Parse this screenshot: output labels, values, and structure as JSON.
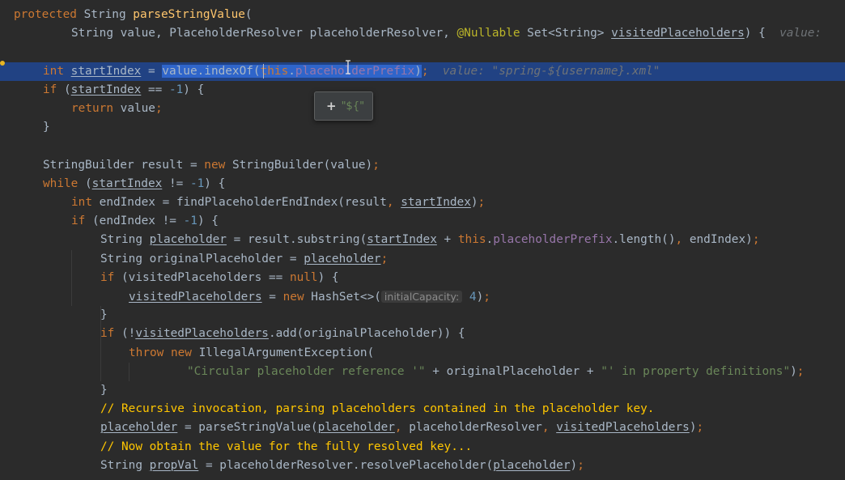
{
  "editor": {
    "language": "java",
    "lines": [
      [
        [
          "kw",
          "protected "
        ],
        [
          "p",
          "String "
        ],
        [
          "fn",
          "parseStringValue"
        ],
        [
          "p",
          "("
        ]
      ],
      [
        [
          "p",
          "String value, PlaceholderResolver placeholderResolver, "
        ],
        [
          "ann",
          "@Nullable "
        ],
        [
          "p",
          "Set<String> "
        ],
        [
          "ul",
          "visitedPlaceholders"
        ],
        [
          "p",
          ") {  "
        ],
        [
          "inlay",
          "value: "
        ]
      ],
      [],
      [
        [
          "kw",
          "int "
        ],
        [
          "ul",
          "startIndex"
        ],
        [
          "p",
          " = "
        ],
        [
          "sel",
          "value.indexOf("
        ],
        [
          "sel2",
          "this"
        ],
        [
          "sel3",
          "."
        ],
        [
          "selfld",
          "placeholderPrefix"
        ],
        [
          "sel3",
          ")"
        ],
        [
          "kw",
          ";"
        ],
        [
          "p",
          "  "
        ],
        [
          "inlay",
          "value: \"spring-${username}.xml\""
        ]
      ],
      [
        [
          "kw",
          "if "
        ],
        [
          "p",
          "("
        ],
        [
          "ul",
          "startIndex"
        ],
        [
          "p",
          " == "
        ],
        [
          "num",
          "-1"
        ],
        [
          "p",
          ") {"
        ]
      ],
      [
        [
          "kw",
          "return "
        ],
        [
          "p",
          "value"
        ],
        [
          "kw",
          ";"
        ]
      ],
      [
        [
          "p",
          "}"
        ]
      ],
      [],
      [
        [
          "p",
          "StringBuilder result = "
        ],
        [
          "kw",
          "new "
        ],
        [
          "p",
          "StringBuilder(value)"
        ],
        [
          "kw",
          ";"
        ]
      ],
      [
        [
          "kw",
          "while "
        ],
        [
          "p",
          "("
        ],
        [
          "ul",
          "startIndex"
        ],
        [
          "p",
          " != "
        ],
        [
          "num",
          "-1"
        ],
        [
          "p",
          ") {"
        ]
      ],
      [
        [
          "kw",
          "int "
        ],
        [
          "p",
          "endIndex = findPlaceholderEndIndex(result"
        ],
        [
          "kw",
          ", "
        ],
        [
          "ul",
          "startIndex"
        ],
        [
          "p",
          ")"
        ],
        [
          "kw",
          ";"
        ]
      ],
      [
        [
          "kw",
          "if "
        ],
        [
          "p",
          "(endIndex != "
        ],
        [
          "num",
          "-1"
        ],
        [
          "p",
          ") {"
        ]
      ],
      [
        [
          "p",
          "String "
        ],
        [
          "ul",
          "placeholder"
        ],
        [
          "p",
          " = result.substring("
        ],
        [
          "ul",
          "startIndex"
        ],
        [
          "p",
          " + "
        ],
        [
          "kw",
          "this"
        ],
        [
          "p",
          "."
        ],
        [
          "fld",
          "placeholderPrefix"
        ],
        [
          "p",
          ".length()"
        ],
        [
          "kw",
          ", "
        ],
        [
          "p",
          "endIndex)"
        ],
        [
          "kw",
          ";"
        ]
      ],
      [
        [
          "p",
          "String originalPlaceholder = "
        ],
        [
          "ul",
          "placeholder"
        ],
        [
          "kw",
          ";"
        ]
      ],
      [
        [
          "kw",
          "if "
        ],
        [
          "p",
          "(visitedPlaceholders == "
        ],
        [
          "kw",
          "null"
        ],
        [
          "p",
          ") {"
        ]
      ],
      [
        [
          "ul",
          "visitedPlaceholders"
        ],
        [
          "p",
          " = "
        ],
        [
          "kw",
          "new "
        ],
        [
          "p",
          "HashSet<>("
        ],
        [
          "hint",
          "initialCapacity:"
        ],
        [
          "num",
          " 4"
        ],
        [
          "p",
          ")"
        ],
        [
          "kw",
          ";"
        ]
      ],
      [
        [
          "p",
          "}"
        ]
      ],
      [
        [
          "kw",
          "if "
        ],
        [
          "p",
          "(!"
        ],
        [
          "ul",
          "visitedPlaceholders"
        ],
        [
          "p",
          ".add(originalPlaceholder)) {"
        ]
      ],
      [
        [
          "kw",
          "throw new "
        ],
        [
          "p",
          "IllegalArgumentException("
        ]
      ],
      [
        [
          "str",
          "\"Circular placeholder reference '\""
        ],
        [
          "p",
          " + originalPlaceholder + "
        ],
        [
          "str",
          "\"' in property definitions\""
        ],
        [
          "p",
          ")"
        ],
        [
          "kw",
          ";"
        ]
      ],
      [
        [
          "p",
          "}"
        ]
      ],
      [
        [
          "cmt",
          "// Recursive invocation, parsing placeholders contained in the placeholder key."
        ]
      ],
      [
        [
          "ul",
          "placeholder"
        ],
        [
          "p",
          " = parseStringValue("
        ],
        [
          "ul",
          "placeholder"
        ],
        [
          "kw",
          ", "
        ],
        [
          "p",
          "placeholderResolver"
        ],
        [
          "kw",
          ", "
        ],
        [
          "ul",
          "visitedPlaceholders"
        ],
        [
          "p",
          ")"
        ],
        [
          "kw",
          ";"
        ]
      ],
      [
        [
          "cmt",
          "// Now obtain the value for the fully resolved key..."
        ]
      ],
      [
        [
          "p",
          "String "
        ],
        [
          "ul",
          "propVal"
        ],
        [
          "p",
          " = placeholderResolver.resolvePlaceholder("
        ],
        [
          "ul",
          "placeholder"
        ],
        [
          "p",
          ")"
        ],
        [
          "kw",
          ";"
        ]
      ]
    ]
  },
  "tooltip": {
    "plus": "+",
    "value": "\"${\""
  },
  "colors": {
    "background": "#2b2b2b",
    "current_line": "#214283",
    "selection": "#2f65ca",
    "keyword": "#cc7832",
    "method": "#ffc66d",
    "string": "#6a8759",
    "number": "#6897bb",
    "field": "#9876aa",
    "comment": "#ffc600"
  }
}
